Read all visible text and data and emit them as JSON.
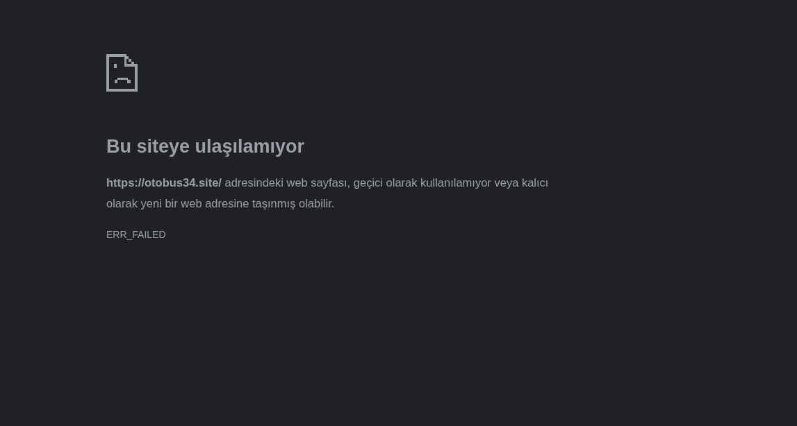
{
  "error_page": {
    "heading": "Bu siteye ulaşılamıyor",
    "message": "**https://otobus34.site/** adresindeki web sayfası, geçici olarak kullanılamıyor veya kalıcı olarak yeni bir web adresine taşınmış olabilir.",
    "error_code": "ERR_FAILED"
  }
}
